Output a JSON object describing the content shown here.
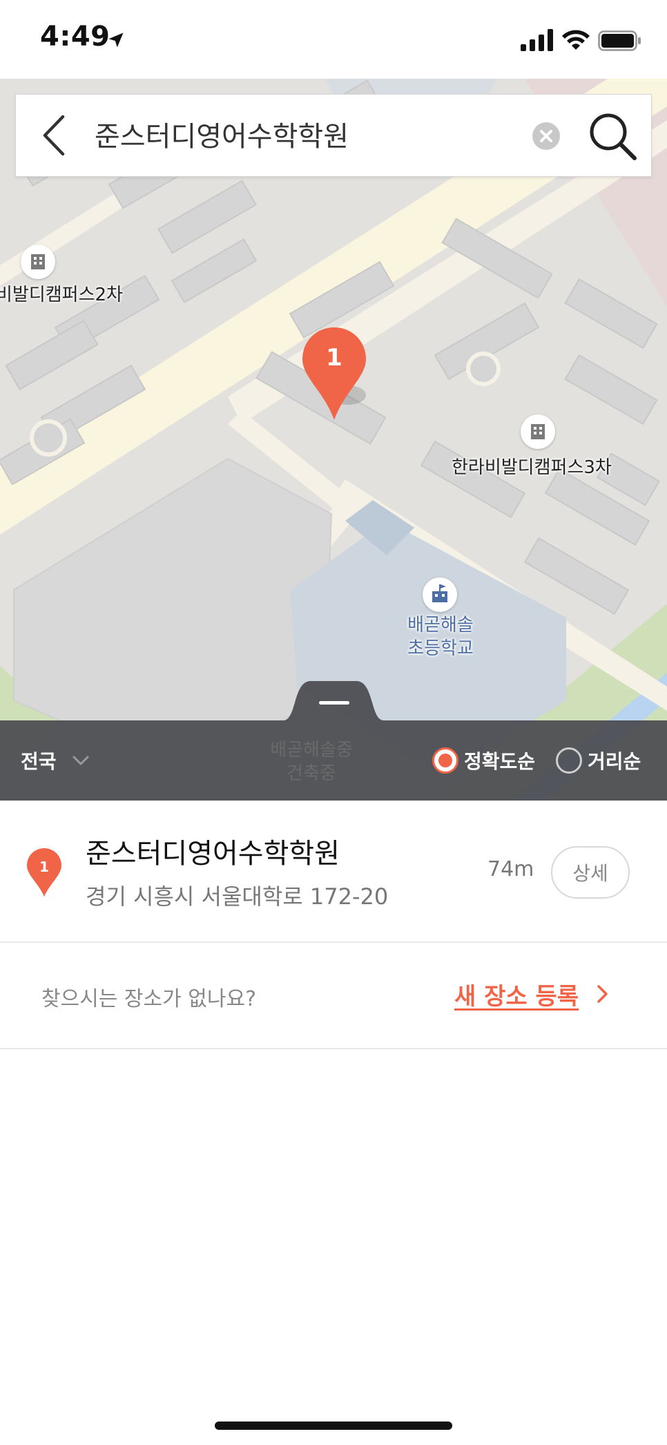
{
  "status_bar": {
    "time": "4:49"
  },
  "search": {
    "query": "준스터디영어수학학원"
  },
  "map": {
    "labels": {
      "campus2": "비발디캠퍼스2차",
      "campus3": "한라비발디캠퍼스3차",
      "school_line1": "배곧해솔",
      "school_line2": "초등학교",
      "middle_line1": "배곧해솔중",
      "middle_line2": "건축중"
    },
    "pin_number": "1"
  },
  "filter": {
    "region": "전국",
    "sort_options": [
      {
        "label": "정확도순",
        "selected": true
      },
      {
        "label": "거리순",
        "selected": false
      }
    ]
  },
  "results": [
    {
      "number": "1",
      "name": "준스터디영어수학학원",
      "address": "경기 시흥시 서울대학로 172-20",
      "distance": "74m",
      "detail_label": "상세"
    }
  ],
  "missing": {
    "text": "찾으시는 장소가 없나요?",
    "register_label": "새 장소 등록"
  },
  "colors": {
    "accent": "#f06448",
    "filter_bg": "#4a4b50"
  }
}
